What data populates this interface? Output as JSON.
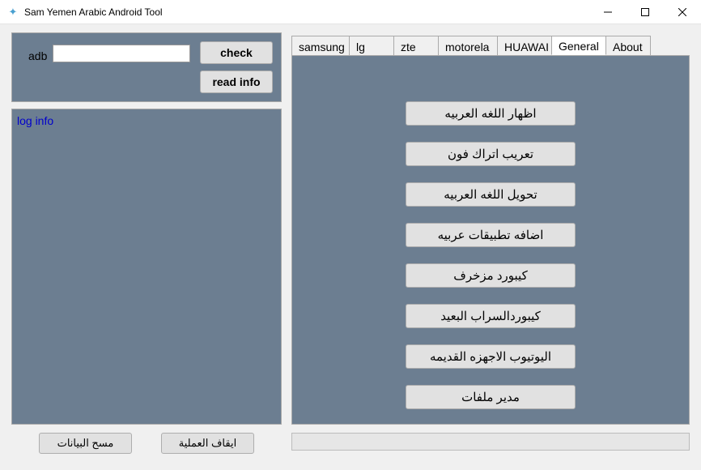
{
  "window": {
    "title": "Sam Yemen Arabic Android Tool"
  },
  "leftTop": {
    "adbLabel": "adb",
    "adbValue": "",
    "checkLabel": "check",
    "readInfoLabel": "read info"
  },
  "log": {
    "header": "log info"
  },
  "bottom": {
    "clearLabel": "مسح البيانات",
    "stopLabel": "ايقاف العملية"
  },
  "tabs": {
    "items": [
      {
        "label": "samsung"
      },
      {
        "label": "lg"
      },
      {
        "label": "zte"
      },
      {
        "label": "motorela"
      },
      {
        "label": "HUAWAI"
      },
      {
        "label": "General"
      },
      {
        "label": "About"
      }
    ],
    "activeIndex": 5
  },
  "generalButtons": [
    "اظهار اللغه العربيه",
    "تعريب اتراك فون",
    "تحويل اللغه العربيه",
    "اضافه تطبيقات عربيه",
    "كيبورد مزخرف",
    "كيبوردالسراب البعيد",
    "اليوتيوب الاجهزه القديمه",
    "مدير ملفات"
  ]
}
